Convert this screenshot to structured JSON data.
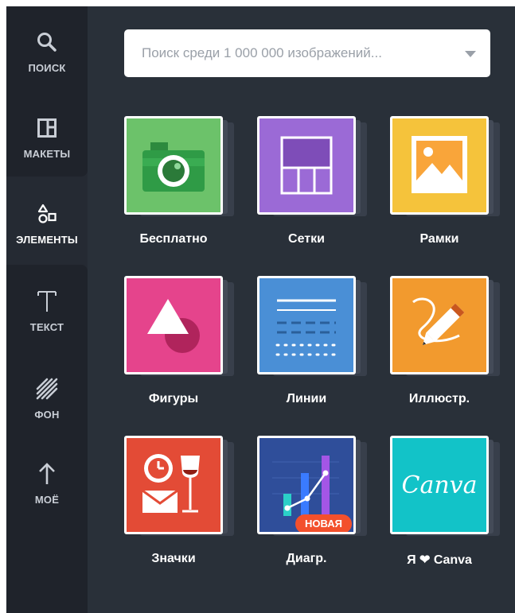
{
  "sidebar": {
    "items": [
      {
        "label": "ПОИСК",
        "icon": "search-icon"
      },
      {
        "label": "МАКЕТЫ",
        "icon": "layout-icon"
      },
      {
        "label": "ЭЛЕМЕНТЫ",
        "icon": "shapes-icon",
        "active": true
      },
      {
        "label": "ТЕКСТ",
        "icon": "text-icon"
      },
      {
        "label": "ФОН",
        "icon": "background-icon"
      },
      {
        "label": "МОЁ",
        "icon": "upload-icon"
      }
    ]
  },
  "search": {
    "placeholder": "Поиск среди 1 000 000 изображений..."
  },
  "tiles": [
    {
      "label": "Бесплатно",
      "color": "#6cc26a"
    },
    {
      "label": "Сетки",
      "color": "#9b6ad6"
    },
    {
      "label": "Рамки",
      "color": "#f5c33b"
    },
    {
      "label": "Фигуры",
      "color": "#e5448c"
    },
    {
      "label": "Линии",
      "color": "#4a8fd6"
    },
    {
      "label": "Иллюстр.",
      "color": "#f29a2e"
    },
    {
      "label": "Значки",
      "color": "#e34b36"
    },
    {
      "label": "Диагр.",
      "color": "#2f4e9a",
      "badge": "НОВАЯ"
    },
    {
      "label_prefix": "Я",
      "label_suffix": "Canva",
      "color": "#12c3c8",
      "card_text": "Canva"
    }
  ],
  "colors": {
    "background": "#293039",
    "sidebar": "#1f232b",
    "active_sidebar": "#252a33"
  }
}
